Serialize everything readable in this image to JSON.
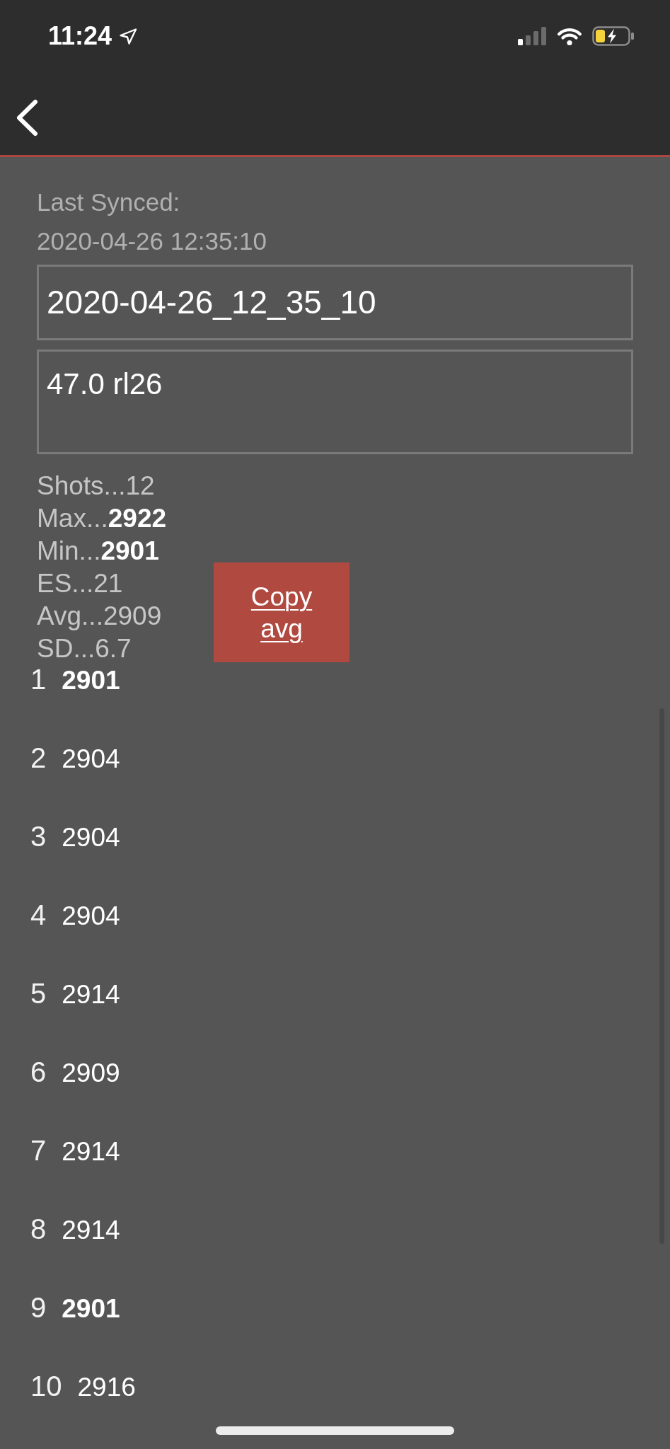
{
  "status_bar": {
    "time": "11:24"
  },
  "sync": {
    "label": "Last Synced:",
    "timestamp": "2020-04-26 12:35:10"
  },
  "fields": [
    {
      "kind": "single_line",
      "value": "2020-04-26_12_35_10"
    },
    {
      "kind": "multi_line",
      "value": "47.0 rl26"
    }
  ],
  "stats": [
    "Shots...12",
    "Max...**2922**",
    "Min...**2901**",
    "ES...21",
    "Avg...2909",
    "SD...6.7"
  ],
  "copy_button": {
    "label": "Copy avg"
  },
  "shots": [
    {
      "number": "1",
      "value": "2901",
      "highlighted": true
    },
    {
      "number": "2",
      "value": "2904",
      "highlighted": false
    },
    {
      "number": "3",
      "value": "2904",
      "highlighted": false
    },
    {
      "number": "4",
      "value": "2904",
      "highlighted": false
    },
    {
      "number": "5",
      "value": "2914",
      "highlighted": false
    },
    {
      "number": "6",
      "value": "2909",
      "highlighted": false
    },
    {
      "number": "7",
      "value": "2914",
      "highlighted": false
    },
    {
      "number": "8",
      "value": "2914",
      "highlighted": false
    },
    {
      "number": "9",
      "value": "2901",
      "highlighted": true
    },
    {
      "number": "10",
      "value": "2916",
      "highlighted": false
    }
  ]
}
